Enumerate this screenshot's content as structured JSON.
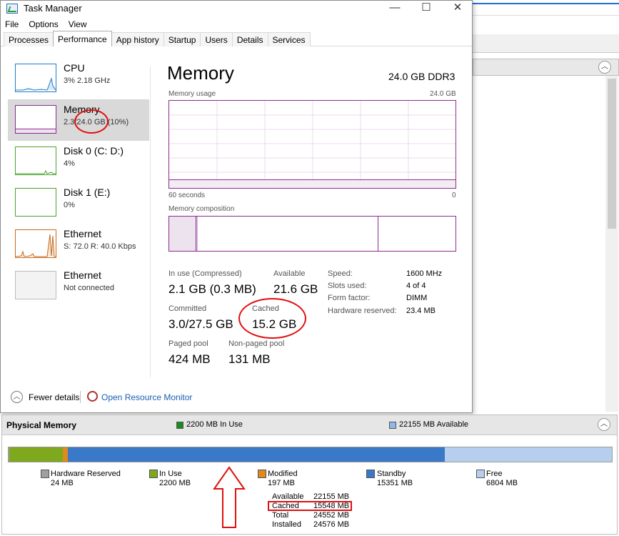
{
  "titlebar": {
    "title": "Task Manager",
    "minimize": "—",
    "maximize": "☐",
    "close": "✕"
  },
  "menu": [
    "File",
    "Options",
    "View"
  ],
  "tabs": [
    "Processes",
    "Performance",
    "App history",
    "Startup",
    "Users",
    "Details",
    "Services"
  ],
  "active_tab": "Performance",
  "resources": [
    {
      "name": "CPU",
      "detail": "3% 2.18 GHz",
      "color": "#1c7cc7"
    },
    {
      "name": "Memory",
      "detail": "2.3/24.0 GB (10%)",
      "color": "#8a2c8f",
      "selected": true
    },
    {
      "name": "Disk 0 (C: D:)",
      "detail": "4%",
      "color": "#4aa02c"
    },
    {
      "name": "Disk 1 (E:)",
      "detail": "0%",
      "color": "#4aa02c"
    },
    {
      "name": "Ethernet",
      "detail": "S: 72.0 R: 40.0 Kbps",
      "color": "#c66a1c"
    },
    {
      "name": "Ethernet",
      "detail": "Not connected",
      "color": "#9a9a9a"
    }
  ],
  "memory": {
    "title": "Memory",
    "spec": "24.0 GB DDR3",
    "usage_label": "Memory usage",
    "usage_max": "24.0 GB",
    "time_left": "60 seconds",
    "time_right": "0",
    "composition_label": "Memory composition",
    "in_use_label": "In use (Compressed)",
    "in_use_value": "2.1 GB (0.3 MB)",
    "available_label": "Available",
    "available_value": "21.6 GB",
    "committed_label": "Committed",
    "committed_value": "3.0/27.5 GB",
    "cached_label": "Cached",
    "cached_value": "15.2 GB",
    "paged_label": "Paged pool",
    "paged_value": "424 MB",
    "nonpaged_label": "Non-paged pool",
    "nonpaged_value": "131 MB",
    "specs": [
      {
        "label": "Speed:",
        "value": "1600 MHz"
      },
      {
        "label": "Slots used:",
        "value": "4 of 4"
      },
      {
        "label": "Form factor:",
        "value": "DIMM"
      },
      {
        "label": "Hardware reserved:",
        "value": "23.4 MB"
      }
    ]
  },
  "footer": {
    "fewer_details": "Fewer details",
    "open_rm": "Open Resource Monitor"
  },
  "physical_memory": {
    "title": "Physical Memory",
    "in_use_header": "2200 MB In Use",
    "available_header": "22155 MB Available",
    "segments": [
      {
        "name": "Hardware Reserved",
        "mb": 24,
        "color": "#a0a0a0"
      },
      {
        "name": "In Use",
        "mb": 2200,
        "color": "#7ea81e"
      },
      {
        "name": "Modified",
        "mb": 197,
        "color": "#e08a1c"
      },
      {
        "name": "Standby",
        "mb": 15351,
        "color": "#3a78c8"
      },
      {
        "name": "Free",
        "mb": 6804,
        "color": "#b7cfee"
      }
    ],
    "legend": [
      {
        "name": "Hardware Reserved",
        "value": "24 MB"
      },
      {
        "name": "In Use",
        "value": "2200 MB"
      },
      {
        "name": "Modified",
        "value": "197 MB"
      },
      {
        "name": "Standby",
        "value": "15351 MB"
      },
      {
        "name": "Free",
        "value": "6804 MB"
      }
    ],
    "summary": [
      {
        "label": "Available",
        "value": "22155 MB"
      },
      {
        "label": "Cached",
        "value": "15548 MB"
      },
      {
        "label": "Total",
        "value": "24552 MB"
      },
      {
        "label": "Installed",
        "value": "24576 MB"
      }
    ]
  }
}
